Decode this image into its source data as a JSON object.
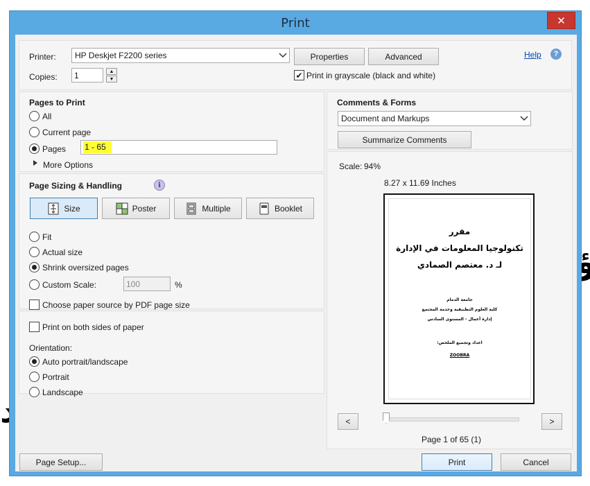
{
  "window": {
    "title": "Print",
    "close_glyph": "✕"
  },
  "printer": {
    "label": "Printer:",
    "selected": "HP Deskjet F2200 series",
    "properties_label": "Properties",
    "advanced_label": "Advanced",
    "help_label": "Help",
    "help_icon_glyph": "?"
  },
  "copies": {
    "label": "Copies:",
    "value": "1",
    "grayscale_label": "Print in grayscale (black and white)",
    "grayscale_checked": true,
    "check_glyph": "✔"
  },
  "pages_to_print": {
    "heading": "Pages to Print",
    "options": [
      {
        "label": "All",
        "selected": false
      },
      {
        "label": "Current page",
        "selected": false
      },
      {
        "label": "Pages",
        "selected": true
      }
    ],
    "pages_value": "1 - 65",
    "more_options_label": "More Options"
  },
  "sizing": {
    "heading": "Page Sizing & Handling",
    "info_glyph": "i",
    "modes": [
      {
        "label": "Size",
        "active": true,
        "icon": "size-icon"
      },
      {
        "label": "Poster",
        "active": false,
        "icon": "poster-icon"
      },
      {
        "label": "Multiple",
        "active": false,
        "icon": "multiple-icon"
      },
      {
        "label": "Booklet",
        "active": false,
        "icon": "booklet-icon"
      }
    ],
    "options": [
      {
        "label": "Fit",
        "selected": false
      },
      {
        "label": "Actual size",
        "selected": false
      },
      {
        "label": "Shrink oversized pages",
        "selected": true
      },
      {
        "label": "Custom Scale:",
        "selected": false
      }
    ],
    "custom_scale_value": "100",
    "custom_scale_unit": "%",
    "paper_source_label": "Choose paper source by PDF page size"
  },
  "both_sides": {
    "label": "Print on both sides of paper"
  },
  "orientation": {
    "label": "Orientation:",
    "options": [
      {
        "label": "Auto portrait/landscape",
        "selected": true
      },
      {
        "label": "Portrait",
        "selected": false
      },
      {
        "label": "Landscape",
        "selected": false
      }
    ]
  },
  "comments": {
    "heading": "Comments & Forms",
    "selected": "Document and Markups",
    "summarize_label": "Summarize Comments"
  },
  "preview": {
    "scale_label": "Scale:",
    "scale_value": "94%",
    "paper_size": "8.27 x 11.69 Inches",
    "page_lines": [
      "مقرر",
      "تكنولوجيا المعلومات في الإدارة",
      "لـ د. معتصم الصمادي"
    ],
    "small_lines": [
      "جامعة الدمام",
      "كلية العلوم التطبيقية وخدمة المجتمع",
      "إدارة أعمال - المستوى السادس"
    ],
    "prep_line": "اعداد وتجميع الملخص:",
    "author_line": "ZOOBRA",
    "prev_glyph": "<",
    "next_glyph": ">",
    "page_indicator": "Page 1 of 65 (1)"
  },
  "footer": {
    "page_setup_label": "Page Setup...",
    "print_label": "Print",
    "cancel_label": "Cancel"
  },
  "colors": {
    "title_bar": "#59a9e3",
    "close": "#c7372f",
    "highlight": "#ffff33"
  }
}
